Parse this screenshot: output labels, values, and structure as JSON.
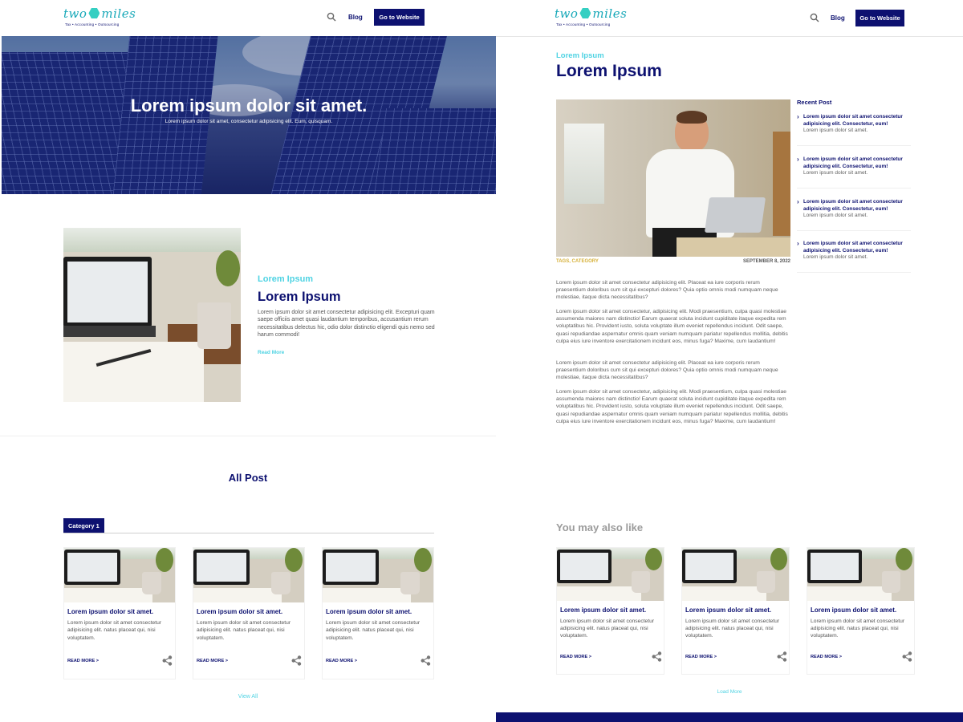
{
  "nav": {
    "logo_left": "two",
    "logo_right": "miles",
    "logo_tagline": "Tax • Accounting • Outsourcing",
    "blog_label": "Blog",
    "cta_label": "Go to Website",
    "search_icon": "search-icon"
  },
  "blog_home": {
    "hero": {
      "title": "Lorem ipsum dolor sit amet.",
      "subtitle": "Lorem ipsum dolor sit amet, consectetur adipisicing elit. Eum, quisquam."
    },
    "featured": {
      "kicker": "Lorem Ipsum",
      "title": "Lorem Ipsum",
      "body": "Lorem ipsum dolor sit amet consectetur adipisicing elit. Excepturi quam saepe officiis amet quasi laudantium temporibus, accusantium rerum necessitatibus delectus hic, odio dolor distinctio eligendi quis nemo sed harum commodi!",
      "read_more": "Read More"
    },
    "all_post_title": "All Post",
    "category_tab": "Category 1",
    "cards": [
      {
        "title": "Lorem ipsum dolor sit amet.",
        "text": "Lorem ipsum dolor sit amet consectetur adipisicing elit. natus placeat qui, nisi voluptatem.",
        "more": "READ MORE >"
      },
      {
        "title": "Lorem ipsum dolor sit amet.",
        "text": "Lorem ipsum dolor sit amet consectetur adipisicing elit. natus placeat qui, nisi voluptatem.",
        "more": "READ MORE >"
      },
      {
        "title": "Lorem ipsum dolor sit amet.",
        "text": "Lorem ipsum dolor sit amet consectetur adipisicing elit. natus placeat qui, nisi voluptatem.",
        "more": "READ MORE >"
      }
    ],
    "view_all": "View All"
  },
  "blog_post": {
    "kicker": "Lorem Ipsum",
    "title": "Lorem Ipsum",
    "tags": "TAGS, CATEGORY",
    "date": "SEPTEMBER 8, 2022",
    "paragraphs": [
      "Lorem ipsum dolor sit amet consectetur adipisicing elit. Placeat ea iure corporis rerum praesentium doloribus cum sit qui excepturi dolores? Quia optio omnis modi numquam neque molestiae, itaque dicta necessitatibus?",
      "Lorem ipsum dolor sit amet consectetur, adipisicing elit. Modi praesentium, culpa quasi molestiae assumenda maiores nam distinctio! Earum quaerat soluta incidunt cupiditate itaque expedita rem voluptatibus hic. Provident iusto, soluta voluptate illum eveniet repellendus incidunt. Odit saepe, quasi repudiandae aspernatur omnis quam veniam numquam pariatur repellendus mollitia, debitis culpa eius iure inventore exercitationem incidunt eos, minus fuga? Maxime, cum laudantium!",
      "Lorem ipsum dolor sit amet consectetur adipisicing elit. Placeat ea iure corporis rerum praesentium doloribus cum sit qui excepturi dolores? Quia optio omnis modi numquam neque molestiae, itaque dicta necessitatibus?",
      "Lorem ipsum dolor sit amet consectetur, adipisicing elit. Modi praesentium, culpa quasi molestiae assumenda maiores nam distinctio! Earum quaerat soluta incidunt cupiditate itaque expedita rem voluptatibus hic. Provident iusto, soluta voluptate illum eveniet repellendus incidunt. Odit saepe, quasi repudiandae aspernatur omnis quam veniam numquam pariatur repellendus mollitia, debitis culpa eius iure inventore exercitationem incidunt eos, minus fuga? Maxime, cum laudantium!"
    ],
    "sidebar": {
      "title": "Recent Post",
      "items": [
        {
          "headline": "Lorem ipsum dolor sit amet consectetur adipisicing elit. Consectetur, eum!",
          "sub": "Lorem ipsum dolor sit amet."
        },
        {
          "headline": "Lorem ipsum dolor sit amet consectetur adipisicing elit. Consectetur, eum!",
          "sub": "Lorem ipsum dolor sit amet."
        },
        {
          "headline": "Lorem ipsum dolor sit amet consectetur adipisicing elit. Consectetur, eum!",
          "sub": "Lorem ipsum dolor sit amet."
        },
        {
          "headline": "Lorem ipsum dolor sit amet consectetur adipisicing elit. Consectetur, eum!",
          "sub": "Lorem ipsum dolor sit amet."
        }
      ]
    },
    "also_like_title": "You may also like",
    "cards": [
      {
        "title": "Lorem ipsum dolor sit amet.",
        "text": "Lorem ipsum dolor sit amet consectetur adipisicing elit. natus placeat qui, nisi voluptatem.",
        "more": "READ MORE >"
      },
      {
        "title": "Lorem ipsum dolor sit amet.",
        "text": "Lorem ipsum dolor sit amet consectetur adipisicing elit. natus placeat qui, nisi voluptatem.",
        "more": "READ MORE >"
      },
      {
        "title": "Lorem ipsum dolor sit amet.",
        "text": "Lorem ipsum dolor sit amet consectetur adipisicing elit. natus placeat qui, nisi voluptatem.",
        "more": "READ MORE >"
      }
    ],
    "load_more": "Load More"
  },
  "colors": {
    "primary": "#0d1170",
    "accent": "#4fd3e3",
    "tags": "#d6b13a"
  }
}
